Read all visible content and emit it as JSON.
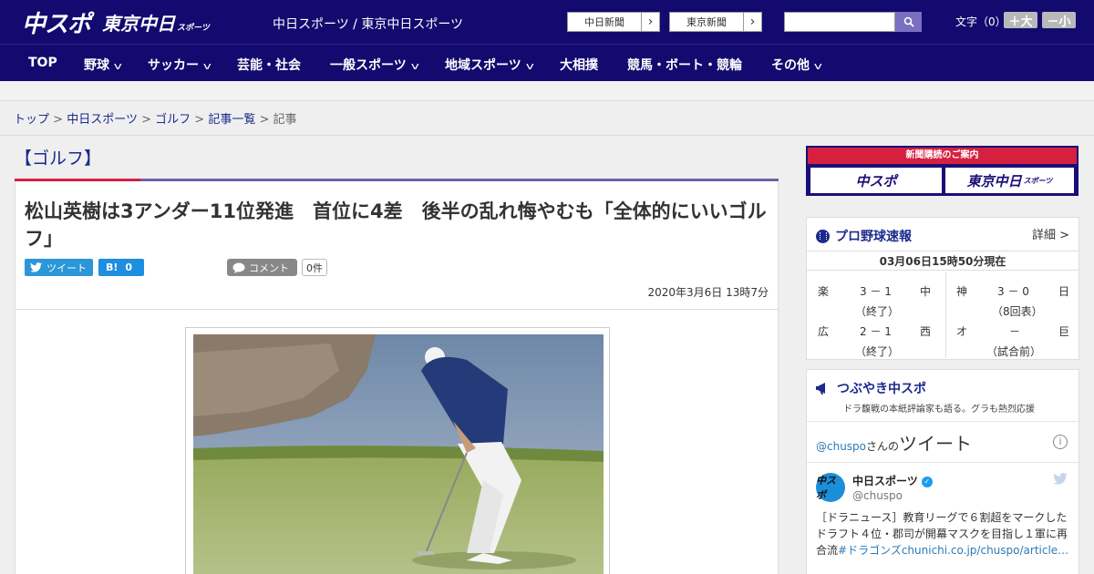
{
  "header": {
    "logo_chuspo": "中スポ",
    "logo_tokyo": "東京中日",
    "logo_tokyo_sub": "スポーツ",
    "site_links": "中日スポーツ / 東京中日スポーツ",
    "ext_chunichi": "中日新聞",
    "ext_tokyo": "東京新聞",
    "search_placeholder": "",
    "fontsize_label": "文字（0）",
    "font_larger": "＋大",
    "font_smaller": "－小"
  },
  "nav": {
    "items": [
      "TOP",
      "野球",
      "サッカー",
      "芸能・社会",
      "一般スポーツ",
      "地域スポーツ",
      "大相撲",
      "競馬・ボート・競輪",
      "その他"
    ]
  },
  "breadcrumb": {
    "items": [
      "トップ",
      "中日スポーツ",
      "ゴルフ",
      "記事一覧"
    ],
    "current": "記事",
    "separator": ">"
  },
  "article": {
    "category": "【ゴルフ】",
    "headline": "松山英樹は3アンダー11位発進　首位に4差　後半の乱れ悔やむも「全体的にいいゴルフ」",
    "tweet_label": "ツイート",
    "hatebu_label": "B!",
    "hatebu_count": "0",
    "comment_label": "コメント",
    "comment_count": "0件",
    "date": "2020年3月6日 13時7分"
  },
  "sidebar": {
    "ad_header": "新聞購読のご案内",
    "ad_chuspo": "中スポ",
    "ad_tokyo": "東京中日",
    "ad_tokyo_sub": "スポーツ",
    "baseball": {
      "title": "プロ野球速報",
      "detail": "詳細 >",
      "timestamp": "03月06日15時50分現在",
      "games": [
        {
          "home": "楽",
          "score": "3 － 1",
          "away": "中",
          "status": "（終了）"
        },
        {
          "home": "神",
          "score": "3 － 0",
          "away": "日",
          "status": "（8回表）"
        },
        {
          "home": "広",
          "score": "2 － 1",
          "away": "西",
          "status": "（終了）"
        },
        {
          "home": "オ",
          "score": "－",
          "away": "巨",
          "status": "（試合前）"
        }
      ]
    },
    "twitter": {
      "title": "つぶやき中スポ",
      "subtitle": "ドラ馥戦の本紙評論家も語る。グラも熱烈応援",
      "account_prefix": "@chuspo",
      "account_suffix": "さんの",
      "header_big": "ツイート",
      "user_name": "中日スポーツ",
      "user_handle": "@chuspo",
      "avatar_text": "中スポ",
      "tweet_text": "［ドラニュース］教育リーグで６割超をマークしたドラフト４位・郡司が開幕マスクを目指し１軍に再合流",
      "tweet_link": "#ドラゴンズchunichi.co.jp/chuspo/article…"
    }
  }
}
